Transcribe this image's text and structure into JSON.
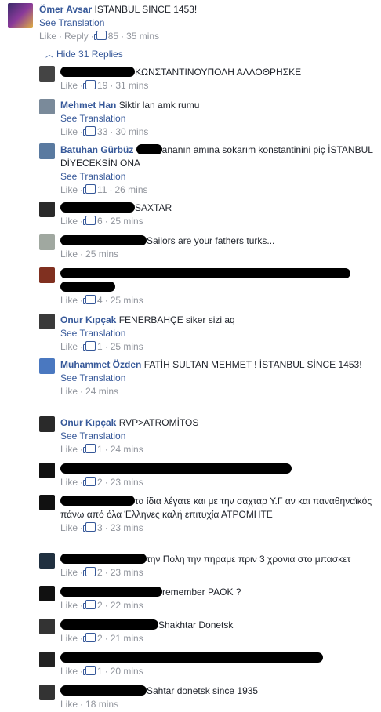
{
  "top_comment": {
    "author": "Ömer Avsar",
    "text": "ISTANBUL SINCE 1453!",
    "see_translation": "See Translation",
    "like": "Like",
    "reply": "Reply",
    "likes": "85",
    "time": "35 mins"
  },
  "hide_replies": "Hide 31 Replies",
  "replies": [
    {
      "author": "",
      "text": "ΚΩΝΣΤΑΝΤΙΝΟΥΠΟΛΗ ΑΛΛΟΘΡΗΣΚΕ",
      "translation": "",
      "likes": "19",
      "time": "31 mins"
    },
    {
      "author": "Mehmet Han",
      "text": "Siktir lan amk rumu",
      "translation": "See Translation",
      "likes": "33",
      "time": "30 mins"
    },
    {
      "author": "Batuhan Gürbüz",
      "text": "ananın amına sokarım konstantinini piç İSTANBUL DİYECEKSİN ONA",
      "translation": "See Translation",
      "likes": "11",
      "time": "26 mins"
    },
    {
      "author": "",
      "text": "SAXTAR",
      "translation": "",
      "likes": "6",
      "time": "25 mins"
    },
    {
      "author": "",
      "text": "Sailors are your fathers turks...",
      "translation": "",
      "likes": "",
      "time": "25 mins"
    },
    {
      "author": "",
      "text": "",
      "translation": "",
      "likes": "4",
      "time": "25 mins"
    },
    {
      "author": "Onur Kıpçak",
      "text": "FENERBAHÇE siker sizi aq",
      "translation": "See Translation",
      "likes": "1",
      "time": "25 mins"
    },
    {
      "author": "Muhammet Özden",
      "text": "FATİH SULTAN MEHMET ! İSTANBUL SİNCE 1453!",
      "translation": "See Translation",
      "likes": "",
      "time": "24 mins"
    },
    {
      "author": "Onur Kıpçak",
      "text": "RVP>ATROMİTOS",
      "translation": "See Translation",
      "likes": "1",
      "time": "24 mins"
    },
    {
      "author": "",
      "text": "",
      "translation": "",
      "likes": "2",
      "time": "23 mins"
    },
    {
      "author": "",
      "text": "τα ίδια λέγατε και με την σαχταρ Υ.Γ αν και παναθηναϊκός πάνω από όλα Έλληνες καλή επιτυχία ΑΤΡΟΜΗΤΕ",
      "translation": "",
      "likes": "3",
      "time": "23 mins"
    },
    {
      "author": "",
      "text": "την Πολη την πηραμε πριν 3 χρονια στο μπασκετ",
      "translation": "",
      "likes": "2",
      "time": "23 mins"
    },
    {
      "author": "",
      "text": "remember PAOK ?",
      "translation": "",
      "likes": "2",
      "time": "22 mins"
    },
    {
      "author": "",
      "text": "Shakhtar Donetsk",
      "translation": "",
      "likes": "2",
      "time": "21 mins"
    },
    {
      "author": "",
      "text": "",
      "translation": "",
      "likes": "1",
      "time": "20 mins"
    },
    {
      "author": "",
      "text": "Sahtar donetsk since 1935",
      "translation": "",
      "likes": "",
      "time": "18 mins"
    }
  ],
  "labels": {
    "like": "Like"
  },
  "colors": {
    "link": "#365899",
    "meta": "#90949c",
    "text": "#1d2129"
  }
}
